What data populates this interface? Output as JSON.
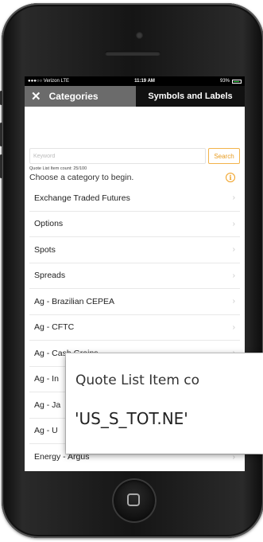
{
  "status_bar": {
    "carrier": "●●●○○ Verizon  LTE",
    "time": "11:19 AM",
    "battery": "93%"
  },
  "nav": {
    "close_glyph": "✕",
    "title": "Categories",
    "symbols_tab": "Symbols and Labels"
  },
  "search": {
    "placeholder": "Keyword",
    "button_label": "Search"
  },
  "count_text": "Quote List Item count: 25/100",
  "prompt": "Choose a category to begin.",
  "info_glyph": "i",
  "categories": [
    "Exchange Traded Futures",
    "Options",
    "Spots",
    "Spreads",
    "Ag - Brazilian CEPEA",
    "Ag - CFTC",
    "Ag - Cash Grains",
    "Ag - In",
    "Ag - Ja",
    "Ag - U",
    "Energy - Argus"
  ],
  "chevron_glyph": "›",
  "tooltip": {
    "line1": "Quote List Item co",
    "line2": "'US_S_TOT.NE'"
  },
  "icons": {
    "close": "close-icon",
    "info": "info-icon",
    "chevron": "chevron-right-icon",
    "battery": "battery-icon",
    "home": "home-square-icon"
  },
  "colors": {
    "nav_left_bg": "#6b6b6b",
    "nav_bg": "#111111",
    "accent_orange": "#e89c20"
  }
}
